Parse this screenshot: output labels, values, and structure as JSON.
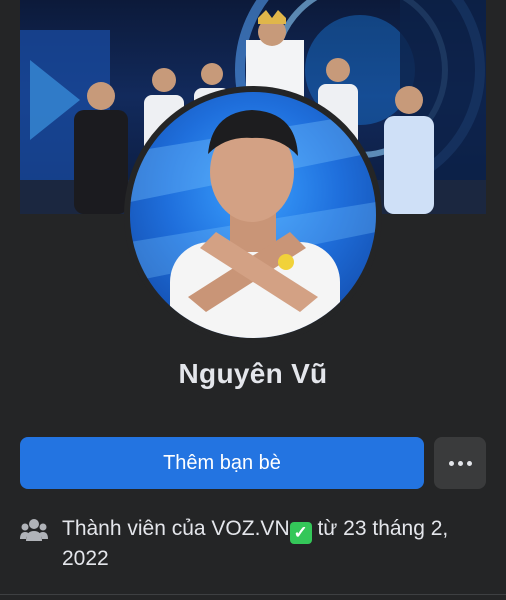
{
  "profile": {
    "name": "Nguyên Vũ",
    "add_friend_label": "Thêm bạn bè",
    "more_icon": "more-dots-icon"
  },
  "info": {
    "icon": "members-icon",
    "text_before": "Thành viên của VOZ.VN",
    "badge_icon": "check-mark-button-icon",
    "badge_glyph": "✓",
    "text_after": " từ 23 tháng 2, 2022"
  },
  "colors": {
    "background": "#242526",
    "primary_button": "#2374e1",
    "secondary_button": "#3a3b3c",
    "text": "#e4e6eb"
  }
}
